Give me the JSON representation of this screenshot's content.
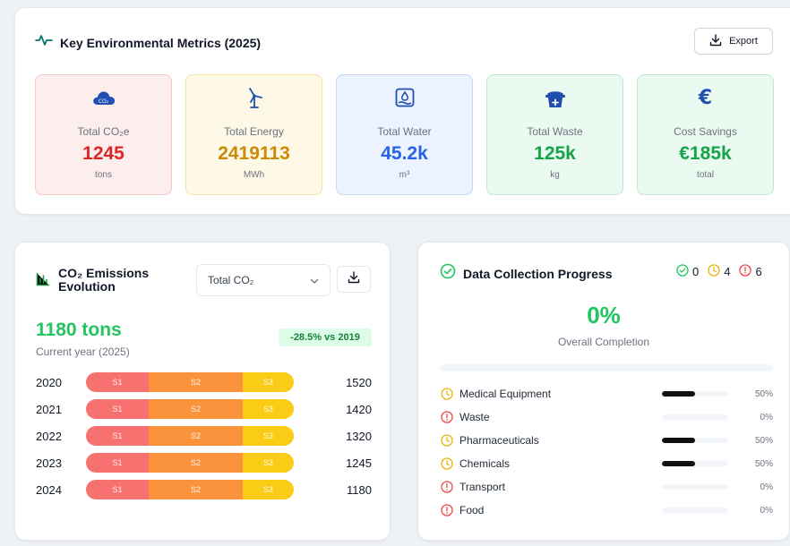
{
  "metrics_card": {
    "title": "Key Environmental Metrics (2025)",
    "export_label": "Export",
    "metrics": [
      {
        "label": "Total CO₂e",
        "value": "1245",
        "unit": "tons",
        "icon": "cloud-co2-icon",
        "color": "#dc2626",
        "bg": "#fdeeee",
        "border": "#f7c6c6"
      },
      {
        "label": "Total Energy",
        "value": "2419113",
        "unit": "MWh",
        "icon": "wind-turbine-icon",
        "color": "#ca8a04",
        "bg": "#fef9e6",
        "border": "#f6e3a1"
      },
      {
        "label": "Total Water",
        "value": "45.2k",
        "unit": "m³",
        "icon": "water-icon",
        "color": "#2563eb",
        "bg": "#ecf2fe",
        "border": "#c6d6f6"
      },
      {
        "label": "Total Waste",
        "value": "125k",
        "unit": "kg",
        "icon": "waste-bin-icon",
        "color": "#16a34a",
        "bg": "#ebfaf0",
        "border": "#bfe9cd"
      },
      {
        "label": "Cost Savings",
        "value": "€185k",
        "unit": "total",
        "icon": "euro-icon",
        "color": "#16a34a",
        "bg": "#ebfaf0",
        "border": "#bfe9cd"
      }
    ]
  },
  "co2_card": {
    "title_line1": "CO₂ Emissions",
    "title_line2": "Evolution",
    "select_value": "Total CO₂",
    "current_value": "1180 tons",
    "current_label": "Current year (2025)",
    "change_badge": "-28.5% vs 2019",
    "segment_labels": [
      "S1",
      "S2",
      "S3"
    ],
    "rows": [
      {
        "year": "2020",
        "total": "1520"
      },
      {
        "year": "2021",
        "total": "1420"
      },
      {
        "year": "2022",
        "total": "1320"
      },
      {
        "year": "2023",
        "total": "1245"
      },
      {
        "year": "2024",
        "total": "1180"
      }
    ]
  },
  "progress_card": {
    "title": "Data Collection Progress",
    "count_complete": "0",
    "count_partial": "4",
    "count_missing": "6",
    "overall_pct": "0%",
    "overall_fraction": 0,
    "overall_label": "Overall Completion",
    "categories": [
      {
        "name": "Medical Equipment",
        "pct": "50%",
        "fraction": 0.5,
        "status": "partial"
      },
      {
        "name": "Waste",
        "pct": "0%",
        "fraction": 0,
        "status": "missing"
      },
      {
        "name": "Pharmaceuticals",
        "pct": "50%",
        "fraction": 0.5,
        "status": "partial"
      },
      {
        "name": "Chemicals",
        "pct": "50%",
        "fraction": 0.5,
        "status": "partial"
      },
      {
        "name": "Transport",
        "pct": "0%",
        "fraction": 0,
        "status": "missing"
      },
      {
        "name": "Food",
        "pct": "0%",
        "fraction": 0,
        "status": "missing"
      }
    ],
    "colors": {
      "complete": "#22c55e",
      "partial": "#eab308",
      "missing": "#ef4444"
    }
  }
}
